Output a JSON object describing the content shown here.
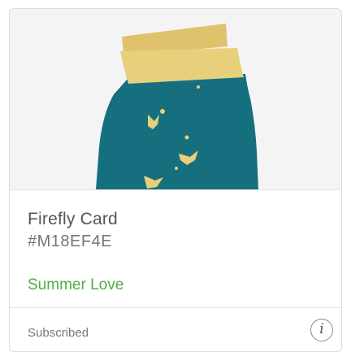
{
  "card": {
    "title": "Firefly Card",
    "code": "#M18EF4E",
    "collection": "Summer Love",
    "status": "Subscribed",
    "info_symbol": "i",
    "colors": {
      "jar": "#166f7f",
      "lid": "#e8cf7c",
      "firefly": "#e8cf7c",
      "collection_text": "#4caf3f"
    }
  }
}
